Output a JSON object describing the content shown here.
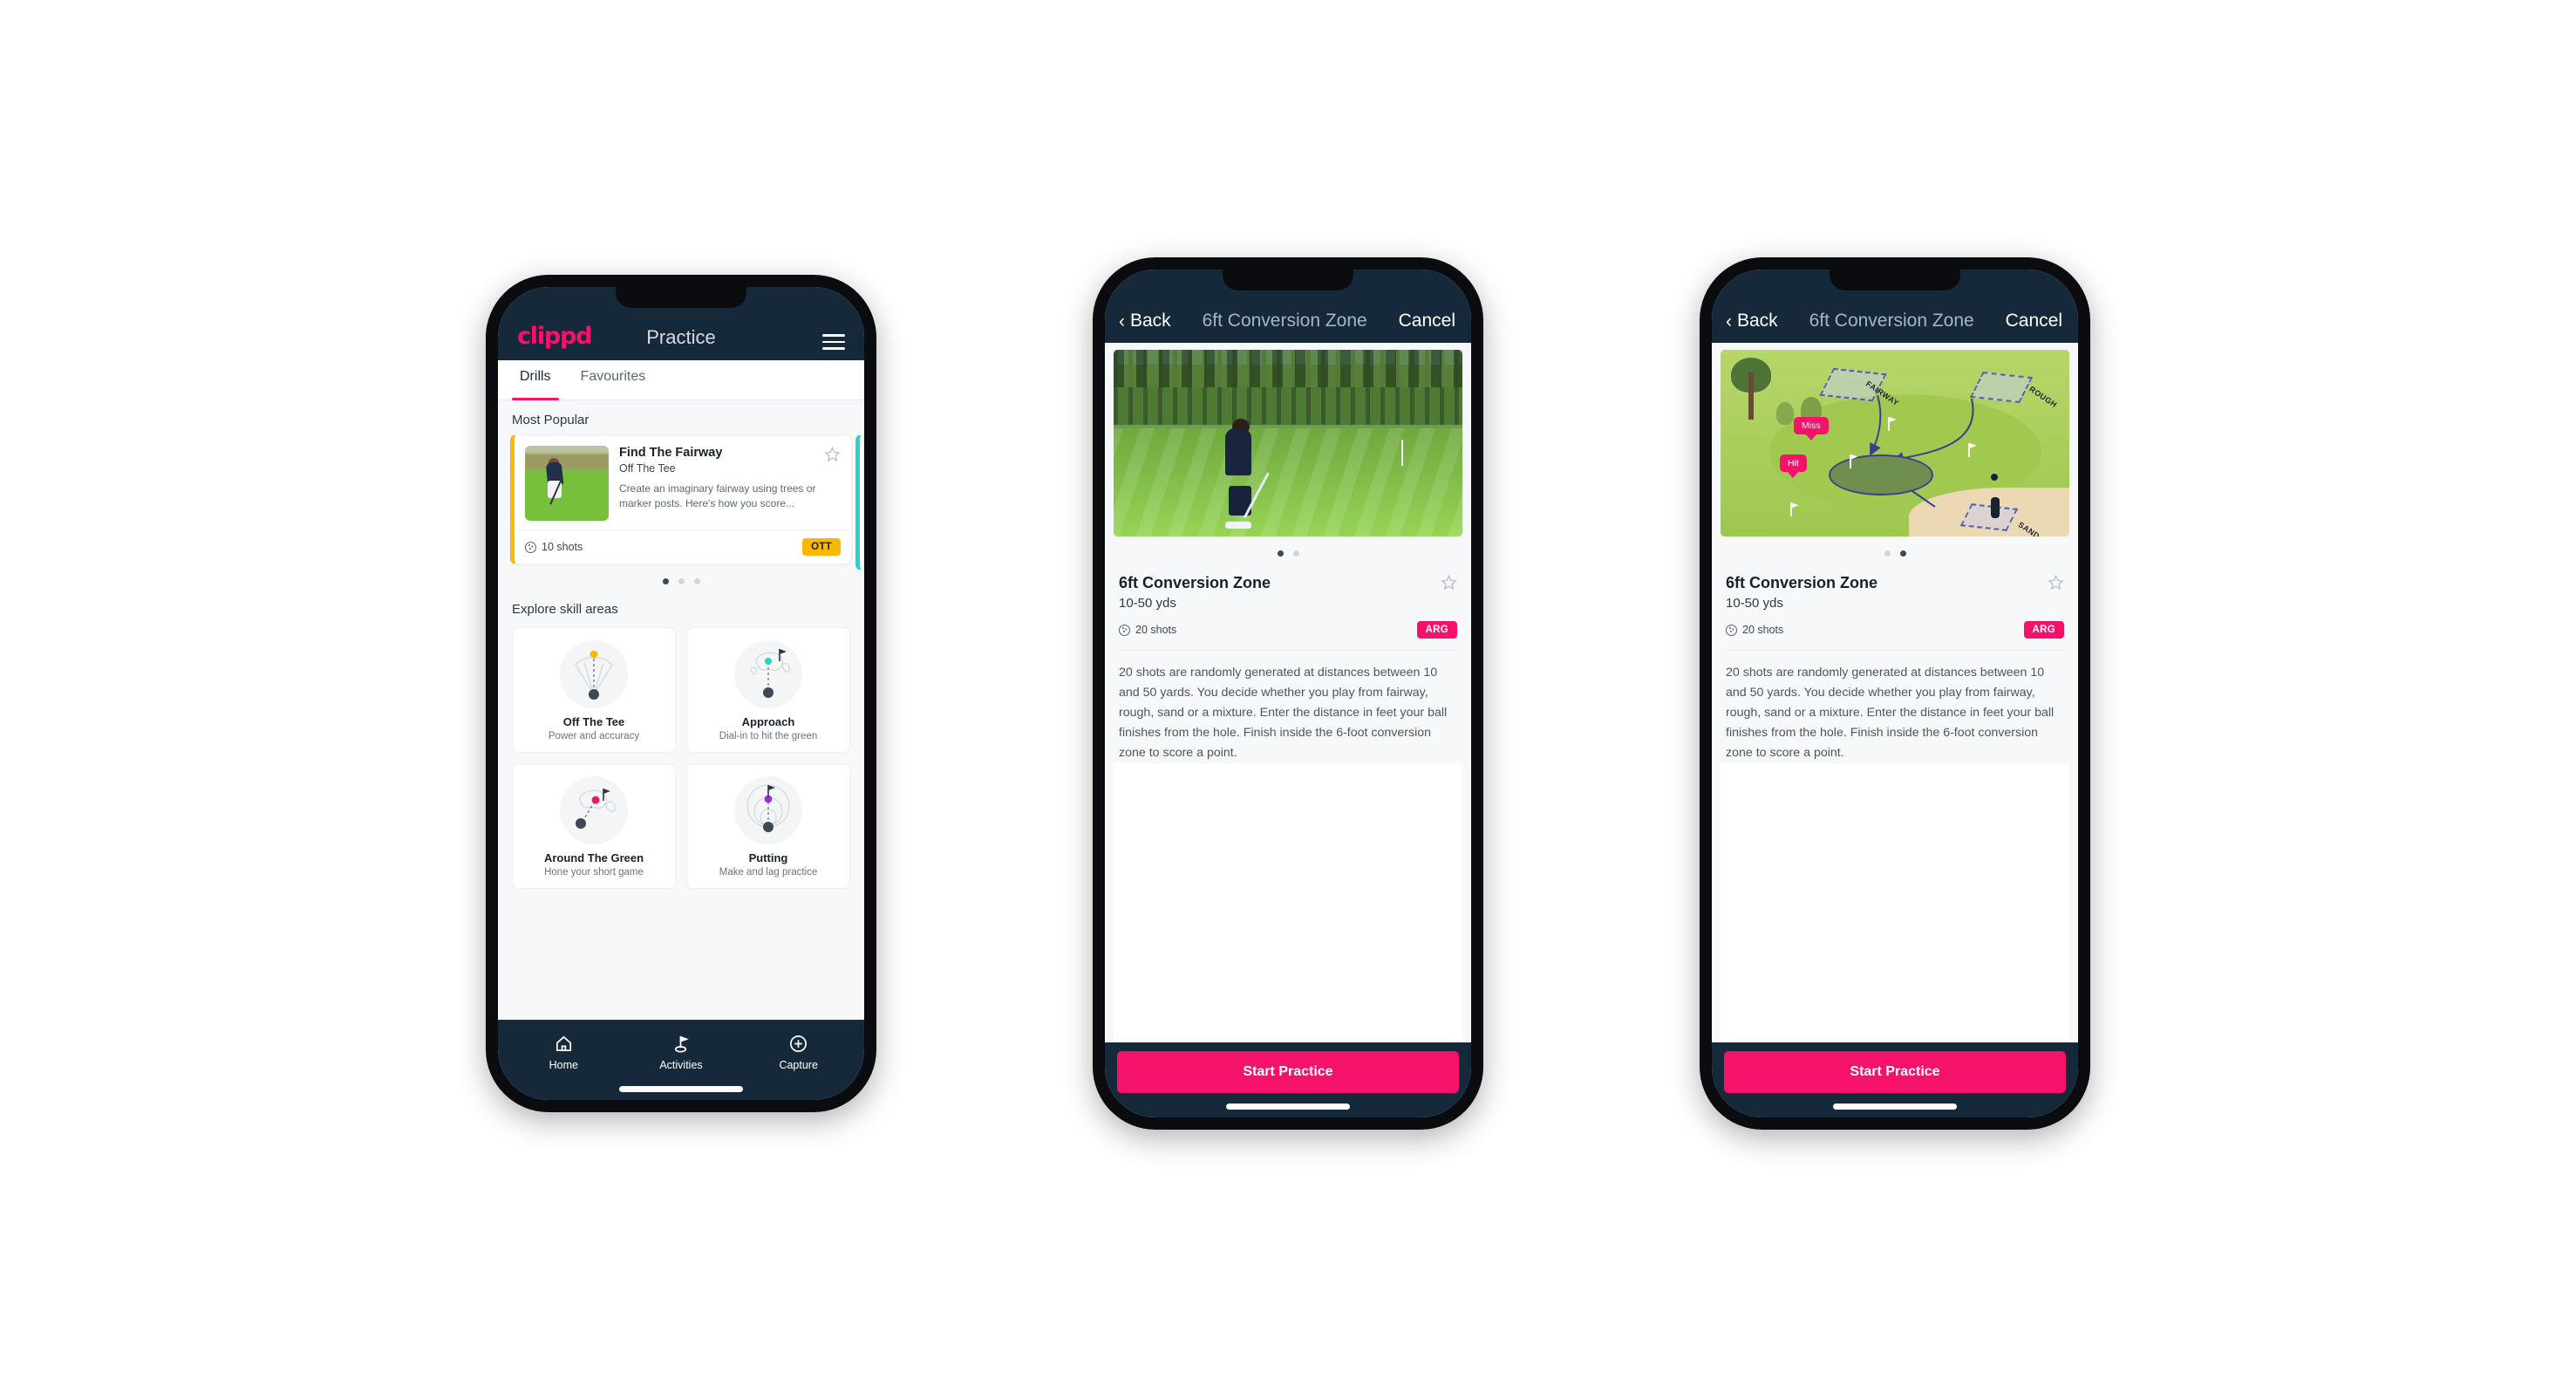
{
  "phone1": {
    "appbar": {
      "brand": "clippd",
      "title": "Practice",
      "menu_icon": "hamburger-icon"
    },
    "tabs": [
      {
        "label": "Drills",
        "active": true
      },
      {
        "label": "Favourites",
        "active": false
      }
    ],
    "sections": {
      "most_popular": "Most Popular",
      "explore": "Explore skill areas"
    },
    "drill": {
      "title": "Find The Fairway",
      "subtitle": "Off The Tee",
      "description": "Create an imaginary fairway using trees or marker posts. Here's how you score...",
      "shots": "10 shots",
      "badge": "OTT",
      "badge_color": "#fbb800",
      "accent_color": "#fbb800",
      "next_accent_color": "#2ad3c5",
      "favourite_icon": "star-outline-icon"
    },
    "carousel_dots": [
      true,
      false,
      false
    ],
    "skills": [
      {
        "name": "Off The Tee",
        "desc": "Power and accuracy",
        "art": "tee-fan-icon",
        "dot_color": "#fbb800"
      },
      {
        "name": "Approach",
        "desc": "Dial-in to hit the green",
        "art": "approach-green-icon",
        "dot_color": "#2ad3c5"
      },
      {
        "name": "Around The Green",
        "desc": "Hone your short game",
        "art": "around-green-icon",
        "dot_color": "#f4126b"
      },
      {
        "name": "Putting",
        "desc": "Make and lag practice",
        "art": "putting-rings-icon",
        "dot_color": "#9b2ed4"
      }
    ],
    "bottomnav": [
      {
        "label": "Home",
        "icon": "home-icon",
        "active": false
      },
      {
        "label": "Activities",
        "icon": "golf-flag-icon",
        "active": true
      },
      {
        "label": "Capture",
        "icon": "plus-circle-icon",
        "active": false
      }
    ]
  },
  "phone2": {
    "navbar": {
      "back": "Back",
      "title": "6ft Conversion Zone",
      "cancel": "Cancel",
      "back_icon": "chevron-left-icon"
    },
    "hero_type": "photo",
    "carousel_dots": [
      true,
      false
    ],
    "detail": {
      "title": "6ft Conversion Zone",
      "yards": "10-50 yds",
      "shots": "20 shots",
      "badge": "ARG",
      "badge_color": "#f4126b",
      "favourite_icon": "star-outline-icon",
      "description": "20 shots are randomly generated at distances between 10 and 50 yards. You decide whether you play from fairway, rough, sand or a mixture. Enter the distance in feet your ball finishes from the hole. Finish inside the 6-foot conversion zone to score a point."
    },
    "cta": "Start Practice"
  },
  "phone3": {
    "navbar": {
      "back": "Back",
      "title": "6ft Conversion Zone",
      "cancel": "Cancel",
      "back_icon": "chevron-left-icon"
    },
    "hero_type": "illustration",
    "illustration": {
      "zone_labels": [
        "FAIRWAY",
        "ROUGH",
        "SAND"
      ],
      "markers": [
        "Miss",
        "Hit"
      ],
      "marker_color": "#f4126b"
    },
    "carousel_dots": [
      false,
      true
    ],
    "detail": {
      "title": "6ft Conversion Zone",
      "yards": "10-50 yds",
      "shots": "20 shots",
      "badge": "ARG",
      "badge_color": "#f4126b",
      "favourite_icon": "star-outline-icon",
      "description": "20 shots are randomly generated at distances between 10 and 50 yards. You decide whether you play from fairway, rough, sand or a mixture. Enter the distance in feet your ball finishes from the hole. Finish inside the 6-foot conversion zone to score a point."
    },
    "cta": "Start Practice"
  }
}
